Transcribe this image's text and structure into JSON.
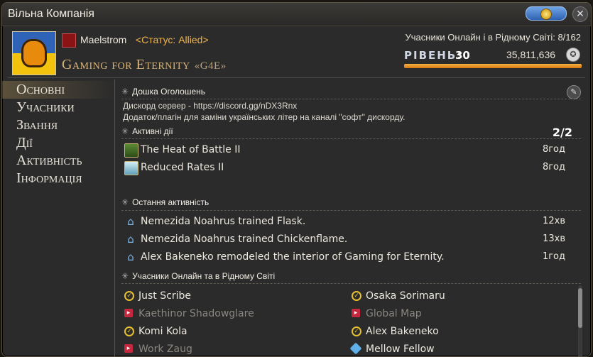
{
  "window": {
    "title": "Вільна Компанія"
  },
  "header": {
    "grand_company": "Maelstrom",
    "status": "<Статус: Allied>",
    "fc_name": "Gaming for Eternity",
    "fc_tag": "«G4E»",
    "online_members": "Учасники Онлайн і в Рідному Світі: 8/162",
    "rank_label": "РІВЕНЬ:",
    "rank_value": "30",
    "credits": "35,811,636",
    "credits_icon": "currency-icon"
  },
  "sidebar": {
    "items": [
      {
        "label": "Основні",
        "active": true
      },
      {
        "label": "Учасники"
      },
      {
        "label": "Звання"
      },
      {
        "label": "Дії"
      },
      {
        "label": "Активність"
      },
      {
        "label": "Інформація"
      }
    ]
  },
  "notice_board": {
    "heading": "Дошка Оголошень",
    "lines": [
      "Дискорд сервер - https://discord.gg/nDX3Rnx",
      "Додаток/плагін для заміни українських літер на каналі \"софт\" дискорду."
    ]
  },
  "active_actions": {
    "heading": "Активні дії",
    "count": "2/2",
    "items": [
      {
        "name": "The Heat of Battle II",
        "time": "8год"
      },
      {
        "name": "Reduced Rates II",
        "time": "8год"
      }
    ]
  },
  "recent_activity": {
    "heading": "Остання активність",
    "items": [
      {
        "text": "Nemezida Noahrus trained Flask.",
        "time": "12хв"
      },
      {
        "text": "Nemezida Noahrus trained Chickenflame.",
        "time": "13хв"
      },
      {
        "text": "Alex Bakeneko remodeled the interior of Gaming for Eternity.",
        "time": "1год"
      }
    ]
  },
  "members_online": {
    "heading": "Учасники Онлайн та в Рідному Світі",
    "left": [
      {
        "name": "Just Scribe",
        "status": "online"
      },
      {
        "name": "Kaethinor Shadowglare",
        "status": "busy"
      },
      {
        "name": "Komi Kola",
        "status": "online"
      },
      {
        "name": "Work Zaug",
        "status": "busy"
      }
    ],
    "right": [
      {
        "name": "Osaka Sorimaru",
        "status": "online"
      },
      {
        "name": "Global Map",
        "status": "busy"
      },
      {
        "name": "Alex Bakeneko",
        "status": "online"
      },
      {
        "name": "Mellow Fellow",
        "status": "other"
      }
    ]
  },
  "colors": {
    "accent_gold": "#d7b47b",
    "status_orange": "#f0b34a",
    "rank_bar": "#e89a28"
  },
  "rank_progress": 1.0
}
